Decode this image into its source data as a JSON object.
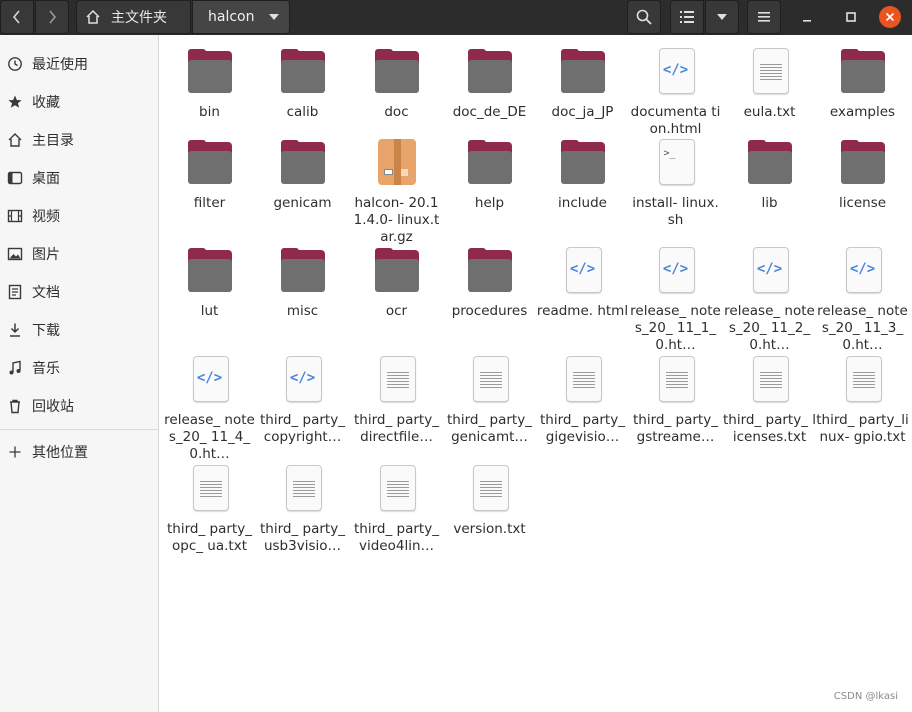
{
  "header": {
    "home_label": "主文件夹",
    "current_folder": "halcon"
  },
  "sidebar": {
    "items": [
      {
        "label": "最近使用",
        "icon": "clock-icon"
      },
      {
        "label": "收藏",
        "icon": "star-icon"
      },
      {
        "label": "主目录",
        "icon": "home-icon"
      },
      {
        "label": "桌面",
        "icon": "desktop-icon"
      },
      {
        "label": "视频",
        "icon": "film-icon"
      },
      {
        "label": "图片",
        "icon": "image-icon"
      },
      {
        "label": "文档",
        "icon": "document-icon"
      },
      {
        "label": "下载",
        "icon": "download-icon"
      },
      {
        "label": "音乐",
        "icon": "music-icon"
      },
      {
        "label": "回收站",
        "icon": "trash-icon"
      },
      {
        "label": "其他位置",
        "icon": "plus-icon"
      }
    ]
  },
  "files": [
    {
      "name": "bin",
      "type": "folder"
    },
    {
      "name": "calib",
      "type": "folder"
    },
    {
      "name": "doc",
      "type": "folder"
    },
    {
      "name": "doc_de_DE",
      "type": "folder"
    },
    {
      "name": "doc_ja_JP",
      "type": "folder"
    },
    {
      "name": "documenta tion.html",
      "type": "html"
    },
    {
      "name": "eula.txt",
      "type": "text"
    },
    {
      "name": "examples",
      "type": "folder"
    },
    {
      "name": "filter",
      "type": "folder"
    },
    {
      "name": "genicam",
      "type": "folder"
    },
    {
      "name": "halcon- 20.11.4.0- linux.tar.gz",
      "type": "archive"
    },
    {
      "name": "help",
      "type": "folder"
    },
    {
      "name": "include",
      "type": "folder"
    },
    {
      "name": "install- linux.sh",
      "type": "script"
    },
    {
      "name": "lib",
      "type": "folder"
    },
    {
      "name": "license",
      "type": "folder"
    },
    {
      "name": "lut",
      "type": "folder"
    },
    {
      "name": "misc",
      "type": "folder"
    },
    {
      "name": "ocr",
      "type": "folder"
    },
    {
      "name": "procedures",
      "type": "folder"
    },
    {
      "name": "readme. html",
      "type": "html"
    },
    {
      "name": "release_ notes_20_ 11_1_0.ht…",
      "type": "html"
    },
    {
      "name": "release_ notes_20_ 11_2_0.ht…",
      "type": "html"
    },
    {
      "name": "release_ notes_20_ 11_3_0.ht…",
      "type": "html"
    },
    {
      "name": "release_ notes_20_ 11_4_0.ht…",
      "type": "html"
    },
    {
      "name": "third_ party_ copyright…",
      "type": "html"
    },
    {
      "name": "third_ party_ directfile…",
      "type": "text"
    },
    {
      "name": "third_ party_ genicamt…",
      "type": "text"
    },
    {
      "name": "third_ party_ gigevisio…",
      "type": "text"
    },
    {
      "name": "third_ party_ gstreame…",
      "type": "text"
    },
    {
      "name": "third_ party_ licenses.txt",
      "type": "text"
    },
    {
      "name": "third_ party_linux- gpio.txt",
      "type": "text"
    },
    {
      "name": "third_ party_opc_ ua.txt",
      "type": "text"
    },
    {
      "name": "third_ party_ usb3visio…",
      "type": "text"
    },
    {
      "name": "third_ party_ video4lin…",
      "type": "text"
    },
    {
      "name": "version.txt",
      "type": "text"
    }
  ],
  "watermark": "CSDN @lkasi",
  "colors": {
    "folder_tab": "#8f2a4a",
    "folder_body": "#6f6f6f",
    "close_button": "#e95420",
    "html_icon": "#4a86d6"
  }
}
